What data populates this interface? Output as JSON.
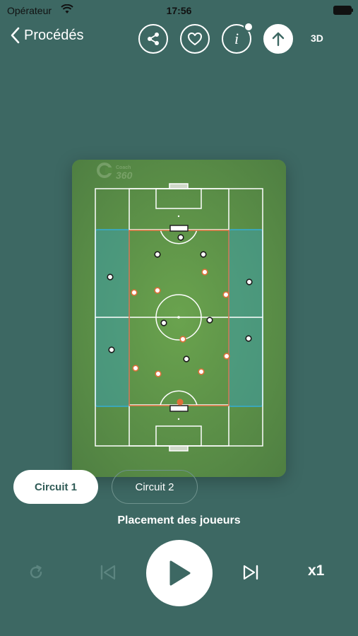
{
  "status_bar": {
    "carrier": "Opérateur",
    "time": "17:56"
  },
  "nav": {
    "back_label": "Procédés",
    "mode_label": "3D",
    "icons": [
      "share-icon",
      "heart-icon",
      "info-icon",
      "upload-icon"
    ]
  },
  "field": {
    "watermark_text": "Coach 360"
  },
  "circuits": [
    {
      "label": "Circuit 1"
    },
    {
      "label": "Circuit 2"
    }
  ],
  "step_title": "Placement des joueurs",
  "playback": {
    "speed": "x1"
  },
  "colors": {
    "background": "#3d6863",
    "field": "#5a8e48",
    "orange": "#e0703a",
    "zone": "#3ba7b8"
  }
}
